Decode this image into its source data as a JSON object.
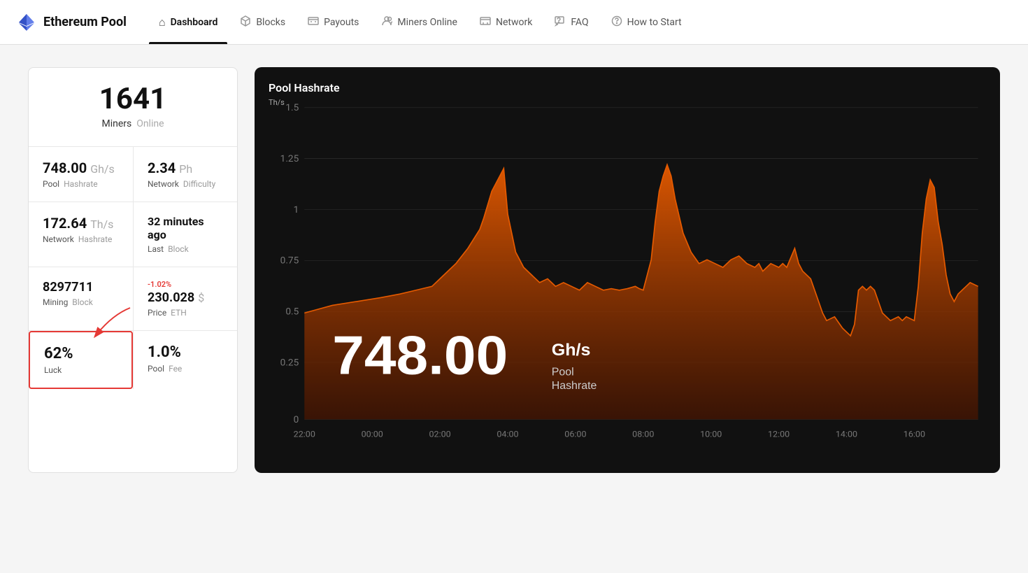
{
  "brand": {
    "name": "Ethereum Pool",
    "icon_label": "ethereum-logo"
  },
  "nav": {
    "items": [
      {
        "id": "dashboard",
        "label": "Dashboard",
        "icon": "🏠",
        "active": true
      },
      {
        "id": "blocks",
        "label": "Blocks",
        "icon": "⬡"
      },
      {
        "id": "payouts",
        "label": "Payouts",
        "icon": "🗂"
      },
      {
        "id": "miners-online",
        "label": "Miners Online",
        "icon": "👤"
      },
      {
        "id": "network",
        "label": "Network",
        "icon": "🖥"
      },
      {
        "id": "faq",
        "label": "FAQ",
        "icon": "💬"
      },
      {
        "id": "how-to-start",
        "label": "How to Start",
        "icon": "?"
      }
    ]
  },
  "stats": {
    "miners_online": {
      "value": "1641",
      "label_main": "Miners",
      "label_muted": "Online"
    },
    "pool_hashrate": {
      "value": "748.00",
      "unit": "Gh/s",
      "label_main": "Pool",
      "label_muted": "Hashrate"
    },
    "network_difficulty": {
      "value": "2.34",
      "unit": "Ph",
      "label_main": "Network",
      "label_muted": "Difficulty"
    },
    "network_hashrate": {
      "value": "172.64",
      "unit": "Th/s",
      "label_main": "Network",
      "label_muted": "Hashrate"
    },
    "last_block": {
      "value": "32 minutes ago",
      "label_main": "Last",
      "label_muted": "Block"
    },
    "mining_block": {
      "value": "8297711",
      "label_main": "Mining",
      "label_muted": "Block"
    },
    "price_eth": {
      "value": "230.028",
      "unit": "$",
      "change": "-1.02%",
      "label_main": "Price",
      "label_muted": "ETH"
    },
    "luck": {
      "value": "62%",
      "label_main": "Luck"
    },
    "pool_fee": {
      "value": "1.0%",
      "label_main": "Pool",
      "label_muted": "Fee"
    }
  },
  "chart": {
    "title": "Pool Hashrate",
    "y_label": "Th/s",
    "y_ticks": [
      "0",
      "0.25",
      "0.5",
      "0.75",
      "1",
      "1.25",
      "1.5"
    ],
    "x_ticks": [
      "22:00",
      "00:00",
      "02:00",
      "04:00",
      "06:00",
      "08:00",
      "10:00",
      "12:00",
      "14:00",
      "16:00"
    ],
    "hashrate_display": "748.00",
    "hashrate_unit": "Gh/s",
    "hashrate_sublabel": "Pool\nHashrate"
  },
  "colors": {
    "accent_orange": "#e55a00",
    "accent_red": "#e53935",
    "brand_dark": "#111111",
    "muted_text": "#999999"
  }
}
